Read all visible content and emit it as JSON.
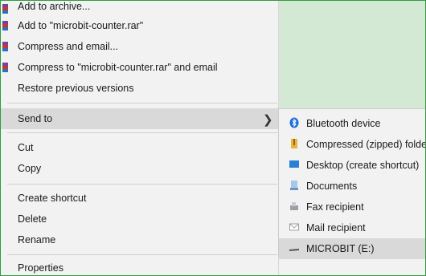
{
  "context_menu": {
    "items": [
      {
        "label": "Add to archive..."
      },
      {
        "label": "Add to \"microbit-counter.rar\""
      },
      {
        "label": "Compress and email..."
      },
      {
        "label": "Compress to \"microbit-counter.rar\" and email"
      },
      {
        "label": "Restore previous versions"
      },
      {
        "label": "Send to"
      },
      {
        "label": "Cut"
      },
      {
        "label": "Copy"
      },
      {
        "label": "Create shortcut"
      },
      {
        "label": "Delete"
      },
      {
        "label": "Rename"
      },
      {
        "label": "Properties"
      }
    ]
  },
  "send_to_menu": {
    "items": [
      {
        "label": "Bluetooth device",
        "icon": "bluetooth-icon"
      },
      {
        "label": "Compressed (zipped) folder",
        "icon": "zip-folder-icon"
      },
      {
        "label": "Desktop (create shortcut)",
        "icon": "desktop-icon"
      },
      {
        "label": "Documents",
        "icon": "documents-icon"
      },
      {
        "label": "Fax recipient",
        "icon": "fax-icon"
      },
      {
        "label": "Mail recipient",
        "icon": "mail-icon"
      },
      {
        "label": "MICROBIT (E:)",
        "icon": "drive-icon"
      }
    ]
  },
  "colors": {
    "menu_bg": "#f2f2f2",
    "highlight": "#d9d9d9",
    "border_accent": "#2f9e3c",
    "bluetooth": "#1e6fd9",
    "zip": "#e8b63a",
    "desktop": "#2a7fd6"
  }
}
